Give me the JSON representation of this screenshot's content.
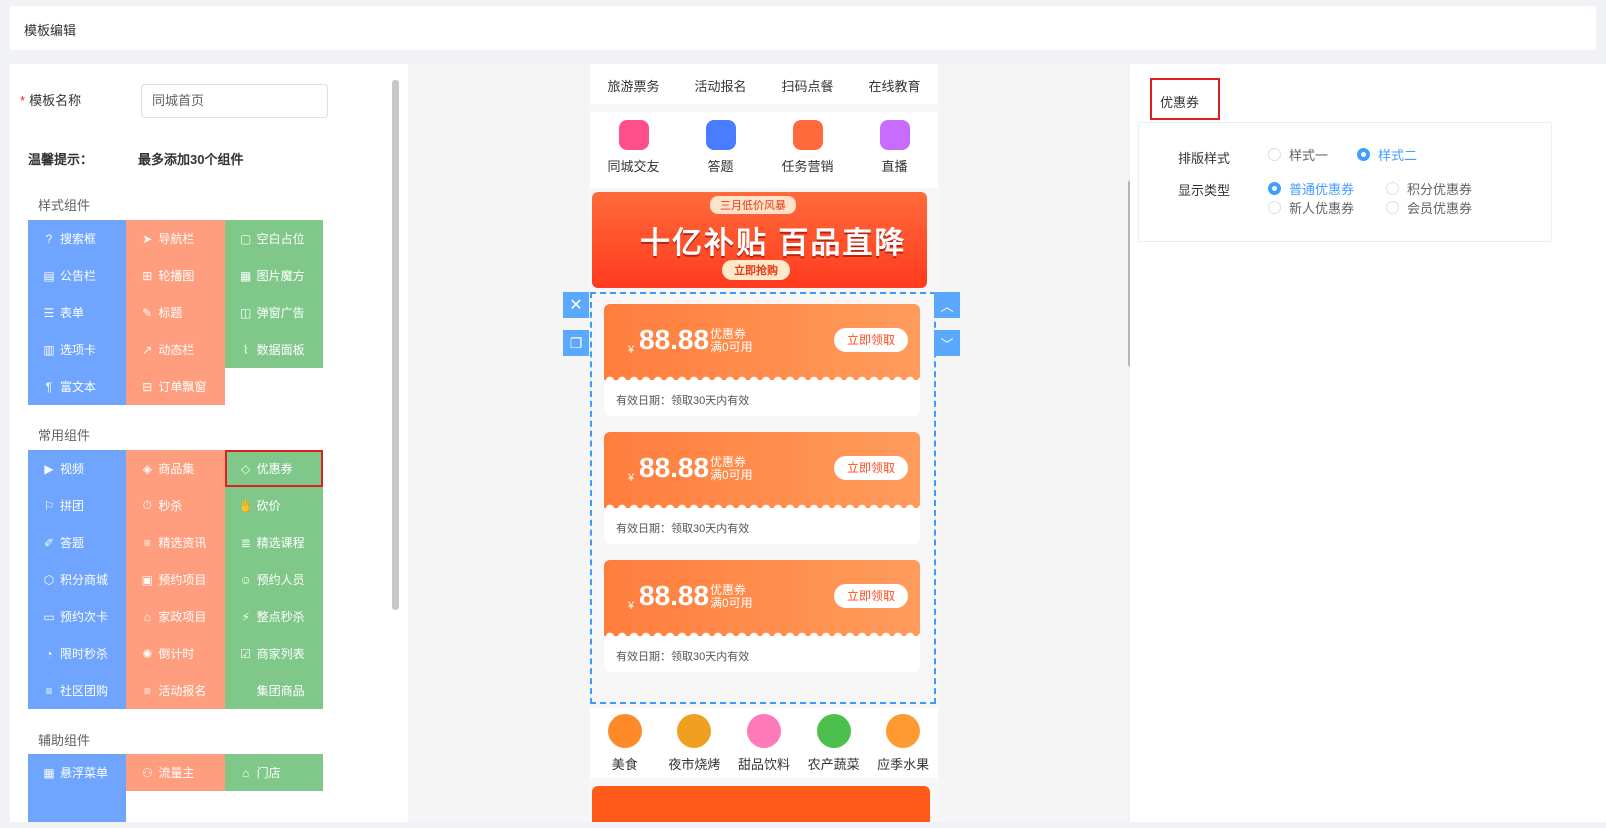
{
  "header": {
    "title": "模板编辑"
  },
  "left": {
    "name_label": "模板名称",
    "name_value": "同城首页",
    "tip_label": "温馨提示：",
    "tip_text": "最多添加30个组件",
    "sections": [
      {
        "title": "样式组件",
        "items": [
          {
            "label": "搜索框",
            "icon": "search-icon",
            "color": "blue"
          },
          {
            "label": "导航栏",
            "icon": "navigation-icon",
            "color": "orange"
          },
          {
            "label": "空白占位",
            "icon": "blank-icon",
            "color": "green"
          },
          {
            "label": "公告栏",
            "icon": "notice-icon",
            "color": "blue"
          },
          {
            "label": "轮播图",
            "icon": "carousel-icon",
            "color": "orange"
          },
          {
            "label": "图片魔方",
            "icon": "image-cube-icon",
            "color": "green"
          },
          {
            "label": "表单",
            "icon": "form-icon",
            "color": "blue"
          },
          {
            "label": "标题",
            "icon": "title-icon",
            "color": "orange"
          },
          {
            "label": "弹窗广告",
            "icon": "popup-ad-icon",
            "color": "green"
          },
          {
            "label": "选项卡",
            "icon": "tab-icon",
            "color": "blue"
          },
          {
            "label": "动态栏",
            "icon": "dynamic-icon",
            "color": "orange"
          },
          {
            "label": "数据面板",
            "icon": "data-panel-icon",
            "color": "green"
          },
          {
            "label": "富文本",
            "icon": "rich-text-icon",
            "color": "blue"
          },
          {
            "label": "订单飘窗",
            "icon": "order-float-icon",
            "color": "orange"
          }
        ]
      },
      {
        "title": "常用组件",
        "items": [
          {
            "label": "视频",
            "icon": "video-icon",
            "color": "blue"
          },
          {
            "label": "商品集",
            "icon": "goods-icon",
            "color": "orange"
          },
          {
            "label": "优惠券",
            "icon": "coupon-icon",
            "color": "green"
          },
          {
            "label": "拼团",
            "icon": "group-buy-icon",
            "color": "blue"
          },
          {
            "label": "秒杀",
            "icon": "flash-sale-icon",
            "color": "orange"
          },
          {
            "label": "砍价",
            "icon": "bargain-icon",
            "color": "green"
          },
          {
            "label": "答题",
            "icon": "quiz-icon",
            "color": "blue"
          },
          {
            "label": "精选资讯",
            "icon": "news-icon",
            "color": "orange"
          },
          {
            "label": "精选课程",
            "icon": "course-icon",
            "color": "green"
          },
          {
            "label": "积分商城",
            "icon": "points-mall-icon",
            "color": "blue"
          },
          {
            "label": "预约项目",
            "icon": "booking-project-icon",
            "color": "orange"
          },
          {
            "label": "预约人员",
            "icon": "booking-staff-icon",
            "color": "green"
          },
          {
            "label": "预约次卡",
            "icon": "booking-card-icon",
            "color": "blue"
          },
          {
            "label": "家政项目",
            "icon": "housekeeping-icon",
            "color": "orange"
          },
          {
            "label": "整点秒杀",
            "icon": "hourly-sale-icon",
            "color": "green"
          },
          {
            "label": "限时秒杀",
            "icon": "timed-sale-icon",
            "color": "blue"
          },
          {
            "label": "倒计时",
            "icon": "countdown-icon",
            "color": "orange"
          },
          {
            "label": "商家列表",
            "icon": "merchant-list-icon",
            "color": "green"
          },
          {
            "label": "社区团购",
            "icon": "community-buy-icon",
            "color": "blue"
          },
          {
            "label": "活动报名",
            "icon": "event-signup-icon",
            "color": "orange"
          },
          {
            "label": "集团商品",
            "icon": "group-goods-icon",
            "color": "green"
          }
        ]
      },
      {
        "title": "辅助组件",
        "items": [
          {
            "label": "悬浮菜单",
            "icon": "float-menu-icon",
            "color": "blue"
          },
          {
            "label": "流量主",
            "icon": "traffic-icon",
            "color": "orange"
          },
          {
            "label": "门店",
            "icon": "store-icon",
            "color": "green"
          }
        ]
      }
    ]
  },
  "preview": {
    "nav_row1": [
      "旅游票务",
      "活动报名",
      "扫码点餐",
      "在线教育"
    ],
    "nav_row2": [
      {
        "label": "同城交友",
        "icon": "heart-icon",
        "color": "#ff4f8b"
      },
      {
        "label": "答题",
        "icon": "building-icon",
        "color": "#4a7cff"
      },
      {
        "label": "任务营销",
        "icon": "gift-icon",
        "color": "#ff6a3d"
      },
      {
        "label": "直播",
        "icon": "live-icon",
        "color": "#c86bff"
      }
    ],
    "banner": {
      "tag": "三月低价风暴",
      "headline": "十亿补贴 百品直降",
      "button": "立即抢购"
    },
    "coupons": [
      {
        "yen": "¥",
        "amount": "88.88",
        "type": "优惠券",
        "condition": "满0可用",
        "button": "立即领取",
        "valid": "有效日期：领取30天内有效"
      },
      {
        "yen": "¥",
        "amount": "88.88",
        "type": "优惠券",
        "condition": "满0可用",
        "button": "立即领取",
        "valid": "有效日期：领取30天内有效"
      },
      {
        "yen": "¥",
        "amount": "88.88",
        "type": "优惠券",
        "condition": "满0可用",
        "button": "立即领取",
        "valid": "有效日期：领取30天内有效"
      }
    ],
    "bottom_nav": [
      {
        "label": "美食",
        "icon": "food-icon",
        "color": "#ff8a2a"
      },
      {
        "label": "夜市烧烤",
        "icon": "bbq-icon",
        "color": "#f0a020"
      },
      {
        "label": "甜品饮料",
        "icon": "dessert-icon",
        "color": "#ff7ab8"
      },
      {
        "label": "农产蔬菜",
        "icon": "vegetable-icon",
        "color": "#4cbf4c"
      },
      {
        "label": "应季水果",
        "icon": "fruit-icon",
        "color": "#ff9a30"
      }
    ]
  },
  "right": {
    "title": "优惠券",
    "layout_label": "排版样式",
    "layout_options": [
      "样式一",
      "样式二"
    ],
    "display_label": "显示类型",
    "display_options": [
      "普通优惠券",
      "积分优惠券",
      "新人优惠券",
      "会员优惠券"
    ]
  },
  "colors": {
    "blue": "#6fa5ff",
    "orange": "#ff9e7f",
    "green": "#7fc88a",
    "accent": "#409eff",
    "highlight": "#e02020"
  }
}
